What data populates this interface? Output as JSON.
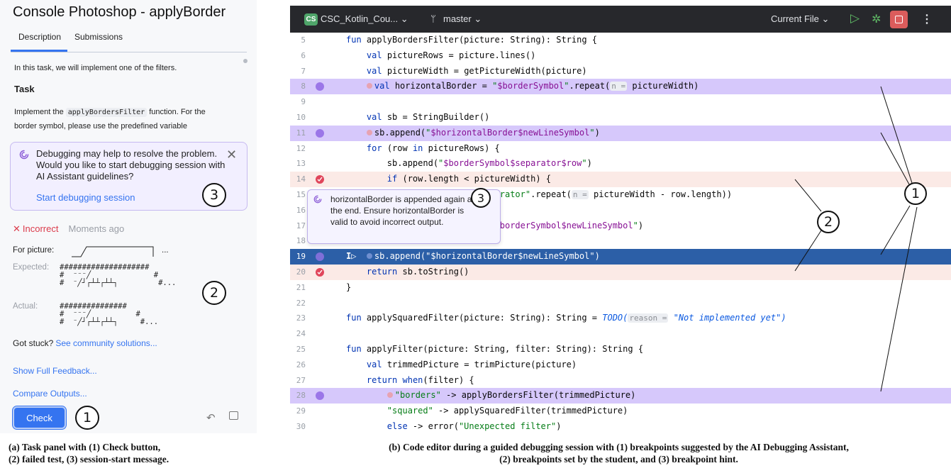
{
  "task_panel": {
    "title": "Console Photoshop - applyBorder",
    "tabs": [
      "Description",
      "Submissions"
    ],
    "intro": "In this task, we will implement one of the filters.",
    "task_heading": "Task",
    "task_text_1": "Implement the ",
    "task_fn": "applyBordersFilter",
    "task_text_2": " function. For the",
    "task_text_3": "border symbol, please use the predefined variable",
    "hint": {
      "message": "Debugging may help to resolve the problem. Would you like to start debugging session with AI Assistant guidelines?",
      "link": "Start debugging session"
    },
    "status": {
      "icon": "x-icon",
      "label": "Incorrect",
      "time": "Moments ago"
    },
    "picture_label": "For picture:",
    "picture_ellipsis": "...",
    "expected_label": "Expected:",
    "expected_art": "####################\n#  ⁻⁻⁻╱              #\n#  ⁻╱┘┌┴┴┌┴┴┐         #...",
    "actual_label": "Actual:",
    "actual_art": "###############\n#  ⁻⁻⁻╱          #\n#  ⁻╱┘┌┴┴┌┴┴┐     #...",
    "stuck_text": "Got stuck?",
    "stuck_link": "See community solutions...",
    "show_feedback": "Show Full Feedback...",
    "compare_outputs": "Compare Outputs...",
    "check_label": "Check",
    "undo_icon": "undo-icon",
    "comment_icon": "comment-icon"
  },
  "callouts": {
    "one": "1",
    "two": "2",
    "three": "3"
  },
  "editor": {
    "project_badge": "CS",
    "project_name": "CSC_Kotlin_Cou... ⌄",
    "branch_name": "master ⌄",
    "run_config": "Current File ⌄",
    "tooltip": "horizontalBorder is appended again at the end. Ensure horizontalBorder is valid to avoid incorrect output.",
    "lines": [
      {
        "n": "5",
        "mark": "",
        "hl": "",
        "html": "<span class=\"kw\">fun</span> applyBordersFilter(picture: String): String {"
      },
      {
        "n": "6",
        "mark": "",
        "hl": "",
        "html": "    <span class=\"kw\">val</span> pictureRows = picture.lines()"
      },
      {
        "n": "7",
        "mark": "",
        "hl": "",
        "html": "    <span class=\"kw\">val</span> pictureWidth = getPictureWidth(picture)"
      },
      {
        "n": "8",
        "mark": "ai",
        "hl": "purple",
        "html": "    <span class=\"dot-inline\"></span><span class=\"kw\">val</span> horizontalBorder = <span class=\"str\">\"</span><span class=\"tpl\">$borderSymbol</span><span class=\"str\">\"</span>.repeat(<span class=\"hint\">n =</span> pictureWidth)"
      },
      {
        "n": "9",
        "mark": "",
        "hl": "",
        "html": ""
      },
      {
        "n": "10",
        "mark": "",
        "hl": "",
        "html": "    <span class=\"kw\">val</span> sb = StringBuilder()"
      },
      {
        "n": "11",
        "mark": "ai",
        "hl": "purple",
        "html": "    <span class=\"dot-inline\"></span>sb.append(<span class=\"str\">\"</span><span class=\"tpl\">$horizontalBorder$newLineSymbol</span><span class=\"str\">\"</span>)"
      },
      {
        "n": "12",
        "mark": "",
        "hl": "",
        "html": "    <span class=\"kw\">for</span> (row <span class=\"kw\">in</span> pictureRows) {"
      },
      {
        "n": "13",
        "mark": "",
        "hl": "",
        "html": "        sb.append(<span class=\"str\">\"</span><span class=\"tpl\">$borderSymbol$separator$row</span><span class=\"str\">\"</span>)"
      },
      {
        "n": "14",
        "mark": "bp",
        "hl": "pink",
        "html": "        <span class=\"kw\">if</span> (row.length &lt; pictureWidth) {"
      },
      {
        "n": "15",
        "mark": "",
        "hl": "",
        "html": "                            <span class=\"str\">parator\"</span>.repeat(<span class=\"hint\">n =</span> pictureWidth - row.length))"
      },
      {
        "n": "16",
        "mark": "",
        "hl": "",
        "html": ""
      },
      {
        "n": "17",
        "mark": "",
        "hl": "",
        "html": "                           <span class=\"tpl\">or$borderSymbol$newLineSymbol</span><span class=\"str\">\"</span>)"
      },
      {
        "n": "18",
        "mark": "",
        "hl": "",
        "html": ""
      },
      {
        "n": "19",
        "mark": "exec",
        "hl": "exec",
        "html": "<span style=\"font-weight:bold\">I▷</span>  <span class=\"dot-inline\" style=\"background:#6f8fd0\"></span>sb.append(\"$horizontalBorder$newLineSymbol\")"
      },
      {
        "n": "20",
        "mark": "bp",
        "hl": "pink",
        "html": "    <span class=\"kw\">return</span> sb.toString()"
      },
      {
        "n": "21",
        "mark": "",
        "hl": "",
        "html": "}"
      },
      {
        "n": "22",
        "mark": "",
        "hl": "",
        "html": ""
      },
      {
        "n": "23",
        "mark": "",
        "hl": "",
        "html": "<span class=\"kw\">fun</span> applySquaredFilter(picture: String): String = <span class=\"it\">TODO(</span><span class=\"hint\">reason =</span> <span class=\"str it\">\"Not implemented yet\"</span><span class=\"it\">)</span>"
      },
      {
        "n": "24",
        "mark": "",
        "hl": "",
        "html": ""
      },
      {
        "n": "25",
        "mark": "",
        "hl": "",
        "html": "<span class=\"kw\">fun</span> applyFilter(picture: String, filter: String): String {"
      },
      {
        "n": "26",
        "mark": "",
        "hl": "",
        "html": "    <span class=\"kw\">val</span> trimmedPicture = trimPicture(picture)"
      },
      {
        "n": "27",
        "mark": "",
        "hl": "",
        "html": "    <span class=\"kw\">return</span> <span class=\"kw\">when</span>(filter) {"
      },
      {
        "n": "28",
        "mark": "ai",
        "hl": "purple",
        "html": "        <span class=\"dot-inline\"></span><span class=\"str\">\"borders\"</span> -&gt; applyBordersFilter(trimmedPicture)"
      },
      {
        "n": "29",
        "mark": "",
        "hl": "",
        "html": "        <span class=\"str\">\"squared\"</span> -&gt; applySquaredFilter(trimmedPicture)"
      },
      {
        "n": "30",
        "mark": "",
        "hl": "",
        "html": "        <span class=\"kw\">else</span> -&gt; error(<span class=\"str\">\"Unexpected filter\"</span>)"
      }
    ]
  },
  "captions": {
    "left_line1": "(a) Task panel with (1) Check button,",
    "left_line2": "(2) failed test, (3) session-start message.",
    "right_line1": "(b) Code editor during a guided debugging session with (1) breakpoints suggested by the AI Debugging Assistant,",
    "right_line2": "(2) breakpoints set by the student, and (3) breakpoint hint."
  },
  "colors": {
    "accent": "#3574f0",
    "ai_highlight": "#d6c8fb",
    "breakpoint_highlight": "#fbeae6",
    "exec_line": "#2c5fa7",
    "error": "#db3b4b"
  }
}
